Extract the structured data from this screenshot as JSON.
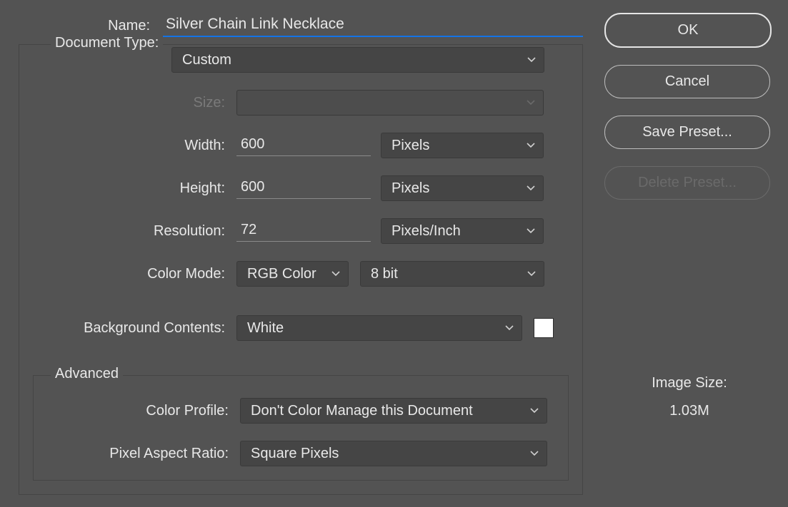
{
  "labels": {
    "name": "Name:",
    "documentType": "Document Type:",
    "size": "Size:",
    "width": "Width:",
    "height": "Height:",
    "resolution": "Resolution:",
    "colorMode": "Color Mode:",
    "backgroundContents": "Background Contents:",
    "advanced": "Advanced",
    "colorProfile": "Color Profile:",
    "pixelAspectRatio": "Pixel Aspect Ratio:",
    "imageSize": "Image Size:"
  },
  "values": {
    "name": "Silver Chain Link Necklace",
    "documentType": "Custom",
    "size": "",
    "width": "600",
    "widthUnit": "Pixels",
    "height": "600",
    "heightUnit": "Pixels",
    "resolution": "72",
    "resolutionUnit": "Pixels/Inch",
    "colorMode": "RGB Color",
    "bitDepth": "8 bit",
    "backgroundContents": "White",
    "backgroundColor": "#ffffff",
    "colorProfile": "Don't Color Manage this Document",
    "pixelAspectRatio": "Square Pixels",
    "imageSizeValue": "1.03M"
  },
  "buttons": {
    "ok": "OK",
    "cancel": "Cancel",
    "savePreset": "Save Preset...",
    "deletePreset": "Delete Preset..."
  }
}
